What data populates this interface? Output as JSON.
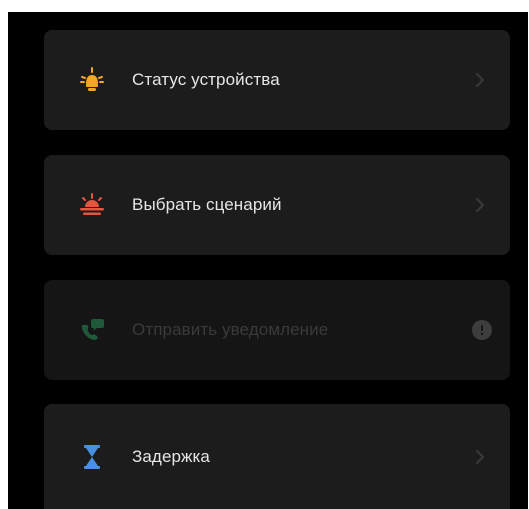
{
  "colors": {
    "background": "#000000",
    "card": "#1c1c1c",
    "card_disabled": "#151515",
    "label": "#e6e6e6",
    "label_disabled": "#3a3a3a",
    "bulb_icon": "#f5a623",
    "sunset_icon": "#e8553f",
    "notify_icon": "#1e5a3a",
    "hourglass_icon": "#4a90e2"
  },
  "menu": {
    "items": [
      {
        "label": "Статус устройства",
        "icon": "lightbulb-icon",
        "trailing": "chevron-right-icon",
        "enabled": true
      },
      {
        "label": "Выбрать сценарий",
        "icon": "sunset-icon",
        "trailing": "chevron-right-icon",
        "enabled": true
      },
      {
        "label": "Отправить уведомление",
        "icon": "phone-message-icon",
        "trailing": "info-icon",
        "enabled": false
      },
      {
        "label": "Задержка",
        "icon": "hourglass-icon",
        "trailing": "chevron-right-icon",
        "enabled": true
      }
    ]
  }
}
